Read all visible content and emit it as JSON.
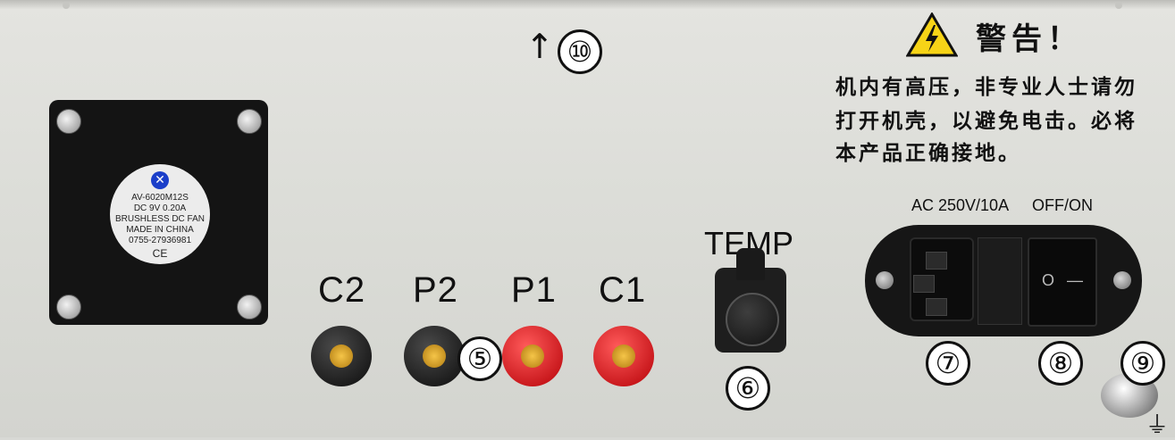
{
  "warning": {
    "title": "警告！",
    "lines": [
      "机内有高压，非专业人士请勿",
      "打开机壳，以避免电击。必将",
      "本产品正确接地。"
    ]
  },
  "top_marker": {
    "arrow": "↑",
    "number": "⑩"
  },
  "fan": {
    "label_lines": [
      "AV-6020M12S",
      "DC  9V  0.20A",
      "BRUSHLESS DC FAN",
      "MADE IN CHINA",
      "0755-27936981",
      "CE"
    ]
  },
  "terminals": {
    "c2": "C2",
    "p2": "P2",
    "p1": "P1",
    "c1": "C1",
    "group_number": "⑤"
  },
  "temp": {
    "label": "TEMP",
    "number": "⑥"
  },
  "power": {
    "spec": "AC 250V/10A",
    "switch_label": "OFF/ON",
    "switch_off_symbol": "O",
    "switch_on_symbol": "—",
    "socket_number": "⑦",
    "switch_number": "⑧"
  },
  "ground": {
    "number": "⑨",
    "symbol": "⏚"
  },
  "colors": {
    "panel": "#dcddd8",
    "warning_yellow": "#f7d417",
    "terminal_red": "#d8161c",
    "terminal_black": "#141414"
  }
}
